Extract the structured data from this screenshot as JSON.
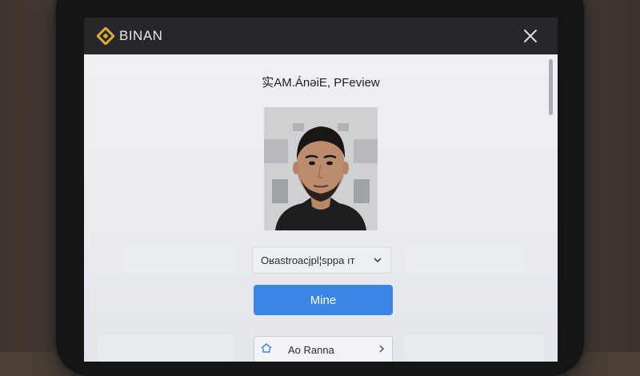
{
  "app": {
    "brand_name": "BINAN",
    "brand_color": "#e0a93a"
  },
  "main": {
    "title": "实AM.ÁnǝiE, PFeview",
    "select": {
      "value": "Oʁastroacjpl¦sppa ıт"
    },
    "primary_button": {
      "label": "Mine",
      "color": "#3c85e6"
    },
    "secondary_row": {
      "label": "Ao Ranna"
    }
  },
  "icons": {
    "brand": "binance-diamond-icon",
    "close": "close-icon",
    "select": "chevron-down-icon",
    "row_left": "home-icon",
    "row_right": "chevron-right-icon"
  }
}
